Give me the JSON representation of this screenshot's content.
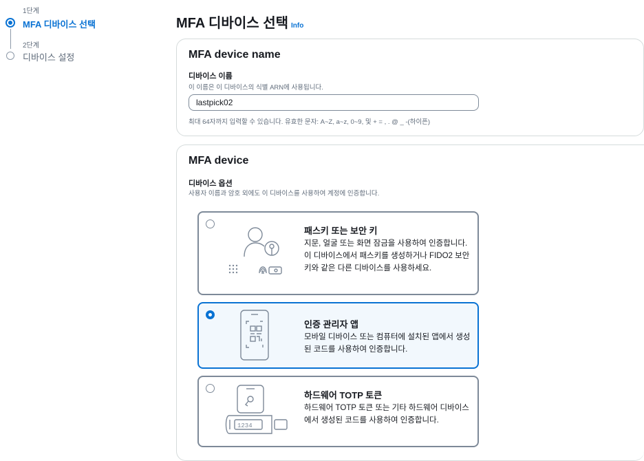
{
  "stepper": {
    "steps": [
      {
        "sub": "1단계",
        "title": "MFA 디바이스 선택"
      },
      {
        "sub": "2단계",
        "title": "디바이스 설정"
      }
    ]
  },
  "header": {
    "title": "MFA 디바이스 선택",
    "info": "Info"
  },
  "device_name": {
    "heading": "MFA device name",
    "label": "디바이스 이름",
    "description": "이 이름은 이 디바이스의 식별 ARN에 사용됩니다.",
    "value": "lastpick02",
    "constraint": "최대 64자까지 입력할 수 있습니다. 유효한 문자: A~Z, a~z, 0~9, 및 + = , . @ _ -(하이픈)"
  },
  "mfa_device": {
    "heading": "MFA device",
    "label": "디바이스 옵션",
    "description": "사용자 이름과 암호 외에도 이 디바이스를 사용하여 계정에 인증합니다.",
    "selected": "authenticator",
    "options": [
      {
        "title": "패스키 또는 보안 키",
        "desc": "지문, 얼굴 또는 화면 잠금을 사용하여 인증합니다. 이 디바이스에서 패스키를 생성하거나 FIDO2 보안 키와 같은 다른 디바이스를 사용하세요.",
        "icon": "passkey-icon"
      },
      {
        "title": "인증 관리자 앱",
        "desc": "모바일 디바이스 또는 컴퓨터에 설치된 앱에서 생성된 코드를 사용하여 인증합니다.",
        "icon": "authenticator-app-icon"
      },
      {
        "title": "하드웨어 TOTP 토큰",
        "desc": "하드웨어 TOTP 토큰 또는 기타 하드웨어 디바이스에서 생성된 코드를 사용하여 인증합니다.",
        "icon": "hardware-token-icon",
        "token_digits": "1234"
      }
    ]
  },
  "colors": {
    "accent": "#0972d3",
    "selected_bg": "#f2f8fd",
    "border": "#7d8998",
    "muted": "#5f6b7a"
  }
}
